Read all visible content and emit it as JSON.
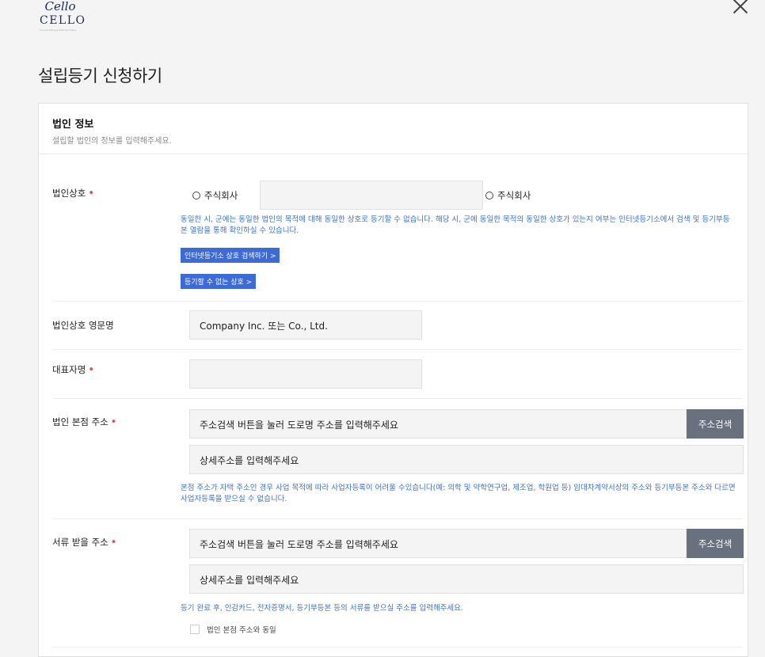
{
  "brand": {
    "script": "Cello",
    "name": "CELLO",
    "tagline": "Incorporating & Startup Online"
  },
  "page": {
    "title": "설립등기 신청하기"
  },
  "section": {
    "title": "법인 정보",
    "subtitle": "설립할 법인의 정보를 입력해주세요."
  },
  "fields": {
    "company_name": {
      "label": "법인상호",
      "required_mark": "•",
      "radio1": "주식회사",
      "radio2": "주식회사",
      "input_value": "",
      "note": "동일한 시, 군에는 동일한 법인의 목적에 대해 동일한 상호로 등기할 수 없습니다. 해당 시, 군에 동일한 목적의 동일한 상호가 있는지 여부는 인터넷등기소에서 검색 및 등기부등본 열람을 통해 확인하실 수 있습니다.",
      "btn_search": "인터넷등기소 상호 검색하기 >",
      "btn_forbidden": "등기할 수 없는 상호 >"
    },
    "english_name": {
      "label": "법인상호 영문명",
      "placeholder": "Company Inc. 또는 Co., Ltd."
    },
    "representative": {
      "label": "대표자명",
      "required_mark": "•",
      "value": ""
    },
    "hq_address": {
      "label": "법인 본점 주소",
      "required_mark": "•",
      "address_placeholder": "주소검색 버튼을 눌러 도로명 주소를 입력해주세요",
      "search_button": "주소검색",
      "detail_placeholder": "상세주소를 입력해주세요",
      "note": "본점 주소가 자택 주소인 경우 사업 목적에 따라 사업자등록이 어려울 수있습니다(예: 의학 및 약학연구업, 제조업, 학원업 등) 임대차계약서상의 주소와 등기부등본 주소와 다르면 사업자등록을 받으실 수 없습니다."
    },
    "doc_address": {
      "label": "서류 받을 주소",
      "required_mark": "•",
      "address_placeholder": "주소검색 버튼을 눌러 도로명 주소를 입력해주세요",
      "search_button": "주소검색",
      "detail_placeholder": "상세주소를 입력해주세요",
      "note": "등기 완료 후, 인감카드, 전자증명서, 등기부등본 등의 서류를 받으실 주소를 입력해주세요.",
      "same_checkbox": "법인 본점 주소와 동일"
    }
  }
}
